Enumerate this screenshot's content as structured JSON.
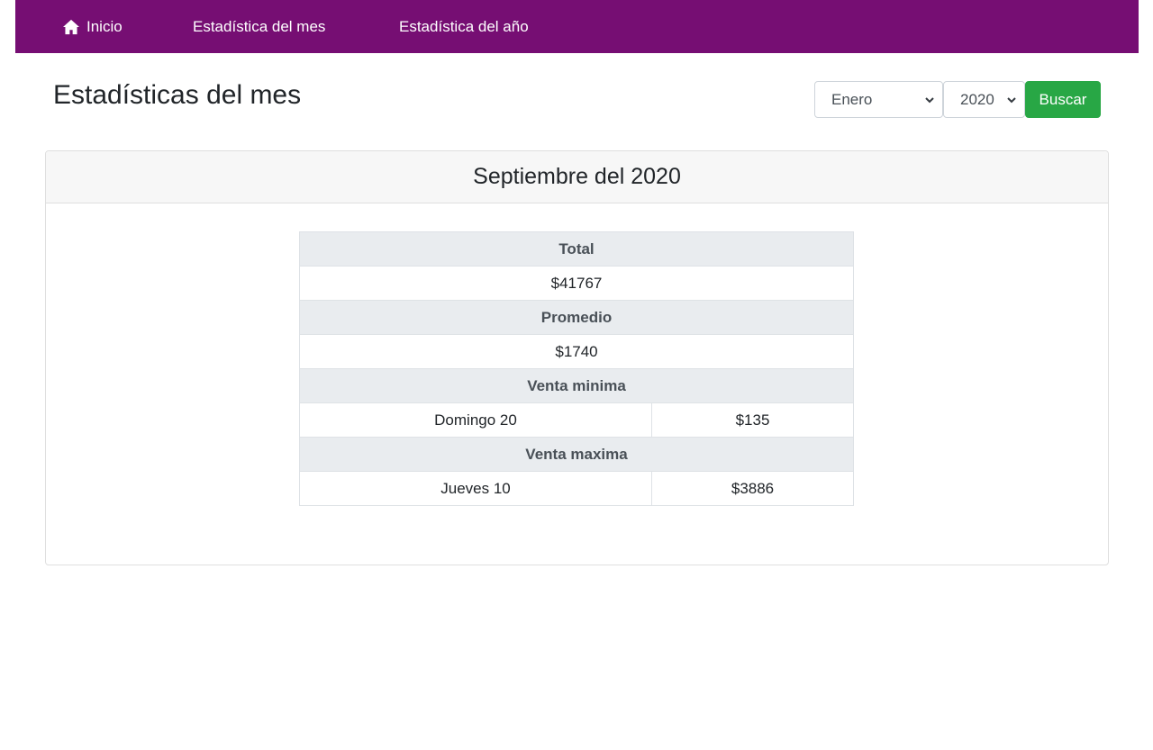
{
  "nav": {
    "home_label": "Inicio",
    "month_stats_label": "Estadística del mes",
    "year_stats_label": "Estadística del año"
  },
  "page": {
    "title": "Estadísticas del mes"
  },
  "filters": {
    "month_value": "Enero",
    "year_value": "2020",
    "search_label": "Buscar"
  },
  "card": {
    "title": "Septiembre del 2020"
  },
  "stats": {
    "total_header": "Total",
    "total_value": "$41767",
    "average_header": "Promedio",
    "average_value": "$1740",
    "min_header": "Venta minima",
    "min_day": "Domingo 20",
    "min_value": "$135",
    "max_header": "Venta maxima",
    "max_day": "Jueves 10",
    "max_value": "$3886"
  },
  "colors": {
    "navbar": "#760e73",
    "search_button": "#28a745",
    "table_header": "#e9ecef"
  },
  "icons": {
    "home": "home-icon",
    "select_arrow": "chevron-down-icon"
  }
}
